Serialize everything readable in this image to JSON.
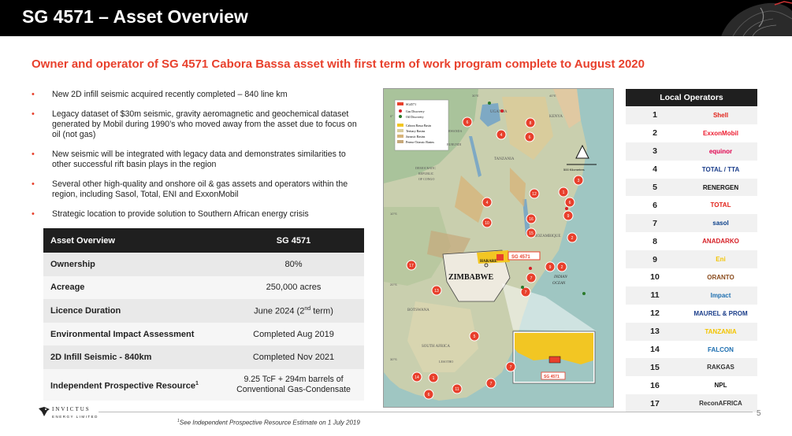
{
  "header": {
    "title": "SG 4571 – Asset Overview"
  },
  "subtitle": "Owner and operator of SG 4571 Cabora Bassa asset with first term of work program complete to August 2020",
  "bullets": [
    "New 2D infill seismic acquired recently completed – 840 line km",
    "Legacy dataset of $30m seismic, gravity aeromagnetic and geochemical dataset generated by Mobil during 1990’s who moved away from the asset due to focus on oil (not gas)",
    "New seismic will be integrated with legacy data and demonstrates similarities to other successful rift basin plays in the region",
    "Several other high-quality and onshore oil & gas assets and operators within the region, including Sasol, Total, ENI and ExxonMobil",
    "Strategic location to provide solution to Southern African energy crisis"
  ],
  "table": {
    "header_label": "Asset Overview",
    "header_value": "SG 4571",
    "rows": [
      {
        "label": "Ownership",
        "value": "80%"
      },
      {
        "label": "Acreage",
        "value": "250,000 acres"
      },
      {
        "label": "Licence Duration",
        "value": "June 2024 (2",
        "value_sup": "nd",
        "value_tail": " term)"
      },
      {
        "label": "Environmental Impact Assessment",
        "value": "Completed Aug 2019"
      },
      {
        "label": "2D Infill Seismic - 840km",
        "value": "Completed Nov 2021"
      },
      {
        "label": "Independent Prospective Resource",
        "label_sup": "1",
        "value_line1": "9.25 TcF + 294m barrels of",
        "value_line2": "Conventional Gas-Condensate"
      }
    ]
  },
  "map": {
    "legend": [
      "SG4571",
      "Gas Discovery",
      "Oil Discovery",
      "Cabora Bassa Basin",
      "Tertiary Basins",
      "Jurassic Basins",
      "Permo-Triassic Basins"
    ],
    "countries": [
      "UGANDA",
      "KENYA",
      "RWANDA",
      "BURUNDI",
      "TANZANIA",
      "DEMOCRATIC",
      "REPUBLIC",
      "OF CONGO",
      "ZIMBABWE",
      "HARARE",
      "BOTSWANA",
      "SOUTH AFRICA",
      "LESOTHO",
      "MOZAMBIQUE",
      "INDIAN",
      "OCEAN"
    ],
    "scale_label": "500 Kilometres",
    "lat_labels": [
      "0°",
      "10°S",
      "20°S",
      "30°S"
    ],
    "lon_labels": [
      "30°E",
      "40°E"
    ],
    "block_label": "SG 4571",
    "inset_label": "SG 4571",
    "markers": [
      "6",
      "4",
      "8",
      "6",
      "3",
      "12",
      "1",
      "6",
      "9",
      "4",
      "16",
      "10",
      "15",
      "2",
      "9",
      "2",
      "7",
      "7",
      "17",
      "13",
      "5",
      "7",
      "14",
      "1",
      "6",
      "11",
      "7"
    ]
  },
  "operators": {
    "title": "Local Operators",
    "rows": [
      {
        "num": "1",
        "logo": "Shell",
        "color": "#e2231a"
      },
      {
        "num": "2",
        "logo": "ExxonMobil",
        "color": "#ed1b2f"
      },
      {
        "num": "3",
        "logo": "equinor",
        "color": "#e0004d"
      },
      {
        "num": "4",
        "logo": "TOTAL / ТТА",
        "color": "#1a3d8a"
      },
      {
        "num": "5",
        "logo": "RENERGEN",
        "color": "#111111"
      },
      {
        "num": "6",
        "logo": "TOTAL",
        "color": "#e2231a"
      },
      {
        "num": "7",
        "logo": "sasol",
        "color": "#0a3f8a"
      },
      {
        "num": "8",
        "logo": "ANADARKO",
        "color": "#d62027"
      },
      {
        "num": "9",
        "logo": "Eni",
        "color": "#f2c400"
      },
      {
        "num": "10",
        "logo": "ORANTO",
        "color": "#8a4b1c"
      },
      {
        "num": "11",
        "logo": "Impact",
        "color": "#1e6fb0"
      },
      {
        "num": "12",
        "logo": "MAUREL & PROM",
        "color": "#1a3d8a"
      },
      {
        "num": "13",
        "logo": "TANZANIA",
        "color": "#f2c400"
      },
      {
        "num": "14",
        "logo": "FALCON",
        "color": "#1e6fb0"
      },
      {
        "num": "15",
        "logo": "RAKGAS",
        "color": "#333333"
      },
      {
        "num": "16",
        "logo": "NPL",
        "color": "#111111"
      },
      {
        "num": "17",
        "logo": "ReconAFRICA",
        "color": "#333333"
      }
    ]
  },
  "footer": {
    "company": "INVICTUS",
    "company_sub": "ENERGY LIMITED",
    "footnote_sup": "1",
    "footnote": "See Independent Prospective Resource Estimate on 1 July 2019",
    "page": "5"
  }
}
